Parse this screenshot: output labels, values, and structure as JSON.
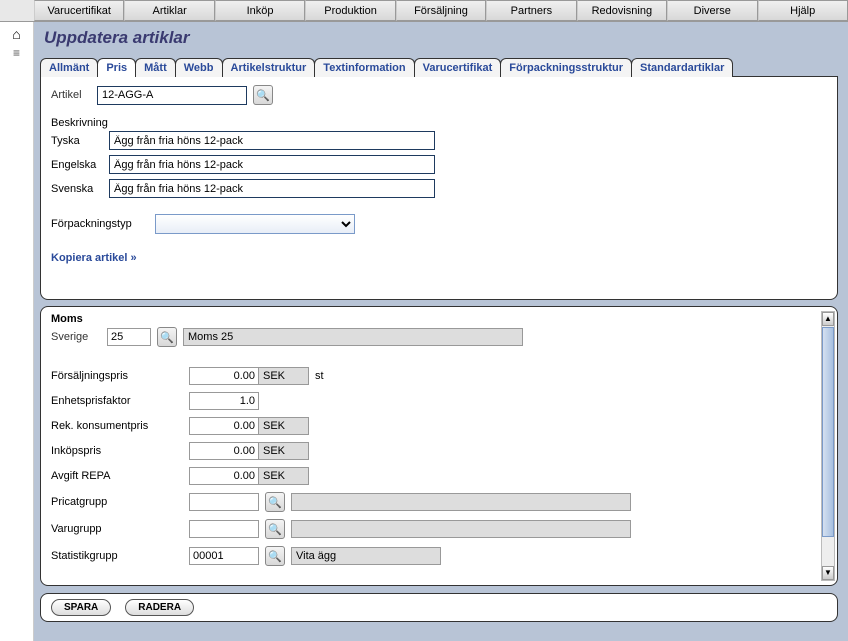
{
  "menubar": [
    "Varucertifikat",
    "Artiklar",
    "Inköp",
    "Produktion",
    "Försäljning",
    "Partners",
    "Redovisning",
    "Diverse",
    "Hjälp"
  ],
  "page_title": "Uppdatera artiklar",
  "tabs": [
    "Allmänt",
    "Pris",
    "Mått",
    "Webb",
    "Artikelstruktur",
    "Textinformation",
    "Varucertifikat",
    "Förpackningsstruktur",
    "Standardartiklar"
  ],
  "active_tab_index": 1,
  "panel1": {
    "artikel_label": "Artikel",
    "artikel_value": "12-AGG-A",
    "beskrivning_label": "Beskrivning",
    "tyska_label": "Tyska",
    "tyska_value": "Ägg från fria höns 12-pack",
    "engelska_label": "Engelska",
    "engelska_value": "Ägg från fria höns 12-pack",
    "svenska_label": "Svenska",
    "svenska_value": "Ägg från fria höns 12-pack",
    "forpackningstyp_label": "Förpackningstyp",
    "kopiera_link": "Kopiera artikel »"
  },
  "panel2": {
    "moms_header": "Moms",
    "sverige_label": "Sverige",
    "sverige_code": "25",
    "sverige_display": "Moms 25",
    "forsaljningspris_label": "Försäljningspris",
    "forsaljningspris_value": "0.00",
    "forsaljningspris_currency": "SEK",
    "forsaljningspris_unit": "st",
    "enhetsprisfaktor_label": "Enhetsprisfaktor",
    "enhetsprisfaktor_value": "1.0",
    "rek_konsumentpris_label": "Rek. konsumentpris",
    "rek_konsumentpris_value": "0.00",
    "rek_konsumentpris_currency": "SEK",
    "inkopspris_label": "Inköpspris",
    "inkopspris_value": "0.00",
    "inkopspris_currency": "SEK",
    "avgift_repa_label": "Avgift REPA",
    "avgift_repa_value": "0.00",
    "avgift_repa_currency": "SEK",
    "pricatgrupp_label": "Pricatgrupp",
    "pricatgrupp_value": "",
    "varugrupp_label": "Varugrupp",
    "varugrupp_value": "",
    "statistikgrupp_label": "Statistikgrupp",
    "statistikgrupp_value": "00001",
    "statistikgrupp_display": "Vita ägg"
  },
  "buttons": {
    "spara": "SPARA",
    "radera": "RADERA"
  },
  "icons": {
    "search": "🔍"
  }
}
